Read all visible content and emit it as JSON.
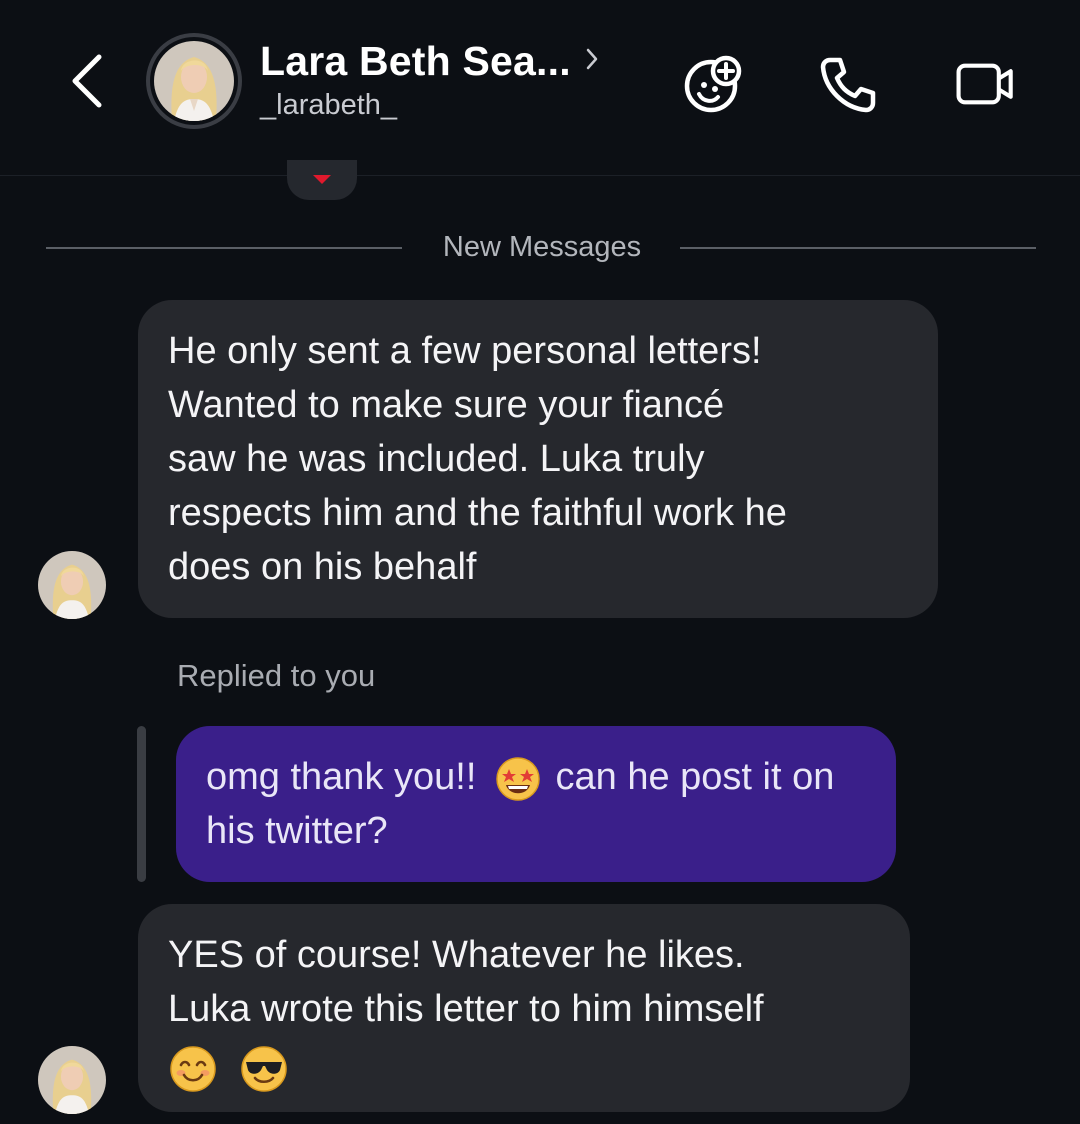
{
  "header": {
    "contact_name": "Lara Beth Sea...",
    "handle": "_larabeth_",
    "back_icon": "chevron-left-icon",
    "add_emoji_icon": "smiley-plus-icon",
    "call_icon": "phone-icon",
    "video_icon": "video-camera-icon"
  },
  "divider": {
    "label": "New Messages"
  },
  "messages": [
    {
      "sender": "them",
      "lines": [
        "He only sent a few personal letters!",
        "Wanted to make sure your fiancé",
        "saw he was included. Luka truly",
        "respects him and the faithful work he",
        "does on his behalf"
      ]
    },
    {
      "sender": "me",
      "reply_label": "Replied to you",
      "lines": [
        "omg thank you!!",
        "can he post it on",
        "his twitter?"
      ],
      "emoji": "star-struck"
    },
    {
      "sender": "them",
      "lines": [
        "YES of course! Whatever he likes.",
        "Luka wrote this letter to him himself"
      ],
      "emojis": [
        "smiling-face",
        "sunglasses-face"
      ]
    }
  ],
  "colors": {
    "background": "#0c0f14",
    "incoming_bubble": "#26282d",
    "outgoing_bubble": "#3a1f8a",
    "reaction_heart": "#e0192d"
  }
}
